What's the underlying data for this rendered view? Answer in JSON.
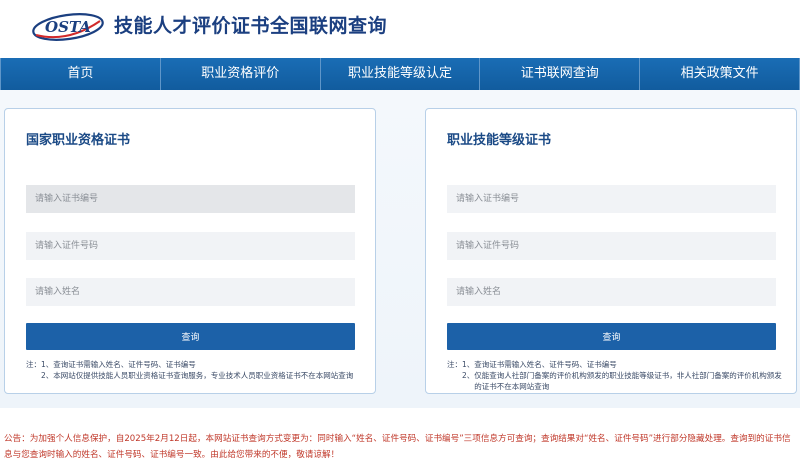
{
  "header": {
    "logo_text": "OSTA",
    "site_title": "技能人才评价证书全国联网查询"
  },
  "nav": {
    "items": [
      {
        "label": "首页"
      },
      {
        "label": "职业资格评价"
      },
      {
        "label": "职业技能等级认定"
      },
      {
        "label": "证书联网查询"
      },
      {
        "label": "相关政策文件"
      }
    ]
  },
  "left_card": {
    "title": "国家职业资格证书",
    "cert_no_placeholder": "请输入证书编号",
    "id_no_placeholder": "请输入证件号码",
    "name_placeholder": "请输入姓名",
    "button_label": "查询",
    "note_prefix": "注：",
    "notes": [
      {
        "num": "1、",
        "text": "查询证书需输入姓名、证件号码、证书编号"
      },
      {
        "num": "2、",
        "text": "本网站仅提供技能人员职业资格证书查询服务，专业技术人员职业资格证书不在本网站查询"
      }
    ]
  },
  "right_card": {
    "title": "职业技能等级证书",
    "cert_no_placeholder": "请输入证书编号",
    "id_no_placeholder": "请输入证件号码",
    "name_placeholder": "请输入姓名",
    "button_label": "查询",
    "note_prefix": "注：",
    "notes": [
      {
        "num": "1、",
        "text": "查询证书需输入姓名、证件号码、证书编号"
      },
      {
        "num": "2、",
        "text": "仅能查询人社部门备案的评价机构颁发的职业技能等级证书，非人社部门备案的评价机构颁发的证书不在本网站查询"
      }
    ]
  },
  "announcement": "公告：为加强个人信息保护，自2025年2月12日起，本网站证书查询方式变更为：同时输入“姓名、证件号码、证书编号”三项信息方可查询；查询结果对“姓名、证件号码”进行部分隐藏处理。查询到的证书信息与您查询时输入的姓名、证件号码、证书编号一致。由此给您带来的不便，敬请谅解！",
  "colors": {
    "nav_bg": "#1a6db5",
    "title_blue": "#1b3f80",
    "button_blue": "#1c61a8",
    "announcement_red": "#c0392b"
  }
}
